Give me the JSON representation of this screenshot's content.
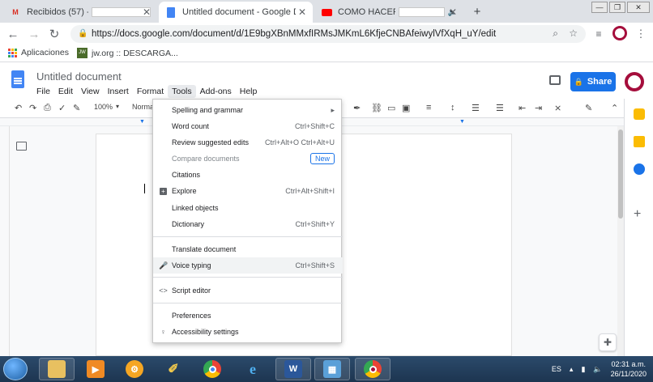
{
  "browser": {
    "tabs": [
      {
        "label": "Recibidos (57) -",
        "icon": "gmail-icon",
        "active": false
      },
      {
        "label": "Untitled document - Google Doc",
        "icon": "docs-icon",
        "active": true
      },
      {
        "label": "COMO HACER",
        "icon": "youtube-icon",
        "active": false
      }
    ],
    "new_tab_label": "+",
    "url": "https://docs.google.com/document/d/1E9bgXBnMMxfIRMsJMKmL6KfjeCNBAfeiwylVfXqH_uY/edit",
    "bookmarks": [
      {
        "label": "Aplicaciones",
        "icon": "apps-grid-icon"
      },
      {
        "label": "jw.org :: DESCARGA...",
        "icon": "jw-icon"
      }
    ]
  },
  "docs": {
    "title": "Untitled document",
    "menu": [
      "File",
      "Edit",
      "View",
      "Insert",
      "Format",
      "Tools",
      "Add-ons",
      "Help"
    ],
    "share_label": "Share",
    "zoom": "100%",
    "style_select": "Norma"
  },
  "tools_menu": {
    "items": [
      {
        "label": "Spelling and grammar",
        "shortcut": "▸",
        "icon": ""
      },
      {
        "label": "Word count",
        "shortcut": "Ctrl+Shift+C",
        "icon": ""
      },
      {
        "label": "Review suggested edits",
        "shortcut": "Ctrl+Alt+O Ctrl+Alt+U",
        "icon": ""
      },
      {
        "label": "Compare documents",
        "badge": "New",
        "icon": "",
        "disabled": true
      },
      {
        "label": "Citations",
        "shortcut": "",
        "icon": ""
      },
      {
        "label": "Explore",
        "shortcut": "Ctrl+Alt+Shift+I",
        "icon": "explore-icon"
      },
      {
        "label": "Linked objects",
        "shortcut": "",
        "icon": ""
      },
      {
        "label": "Dictionary",
        "shortcut": "Ctrl+Shift+Y",
        "icon": ""
      },
      {
        "label": "Translate document",
        "shortcut": "",
        "icon": ""
      },
      {
        "label": "Voice typing",
        "shortcut": "Ctrl+Shift+S",
        "icon": "microphone-icon"
      },
      {
        "label": "Script editor",
        "shortcut": "",
        "icon": "code-icon"
      },
      {
        "label": "Preferences",
        "shortcut": "",
        "icon": ""
      },
      {
        "label": "Accessibility settings",
        "shortcut": "",
        "icon": "accessibility-icon"
      }
    ]
  },
  "taskbar": {
    "language": "ES",
    "time": "02:31 a.m.",
    "date": "26/11/2020"
  },
  "colors": {
    "accent": "#1a73e8",
    "docs_blue": "#4285f4",
    "profile_ring": "#a50e3c"
  }
}
